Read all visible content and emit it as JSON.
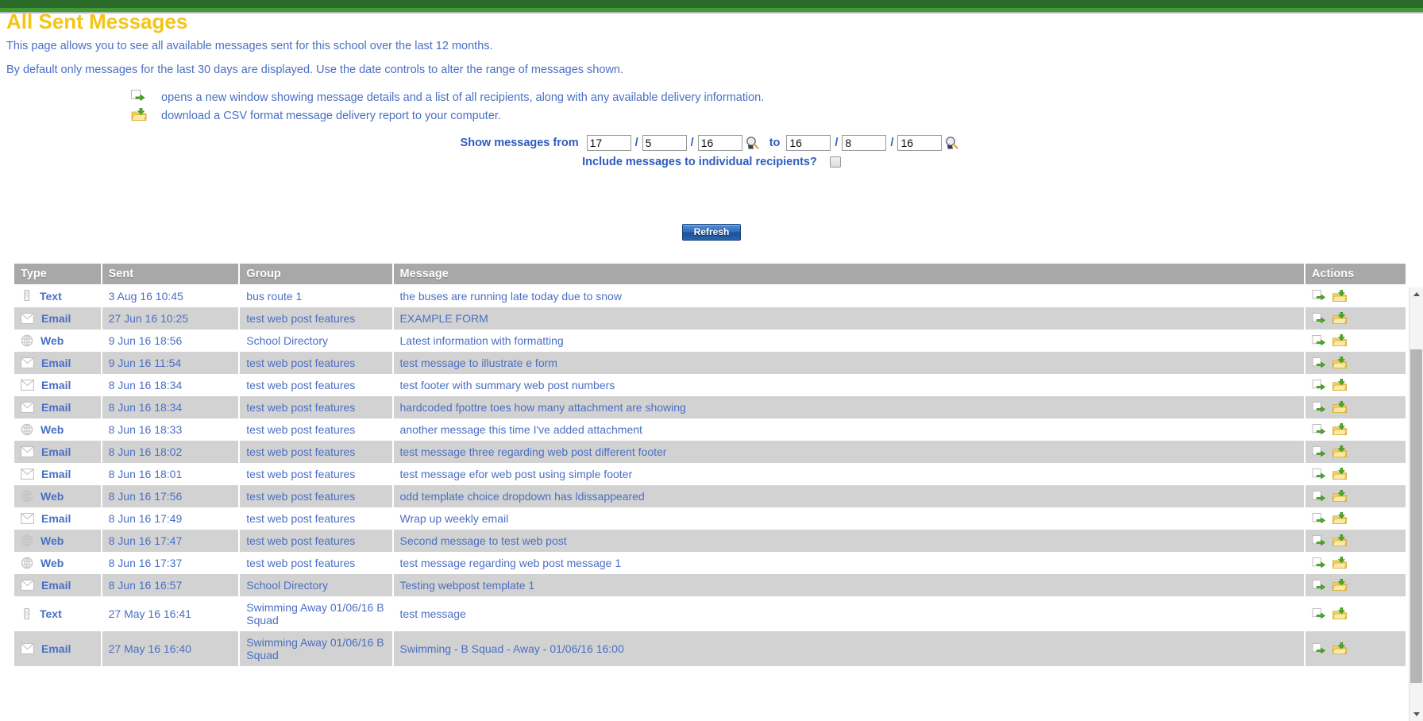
{
  "page": {
    "title": "All Sent Messages",
    "intro_line_1": "This page allows you to see all available messages sent for this school over the last 12 months.",
    "intro_line_2": "By default only messages for the last 30 days are displayed. Use the date controls to alter the range of messages shown.",
    "title_color": "#f2c518",
    "accent_color": "#4a6fc4",
    "bar_color": "#2a6b2a"
  },
  "legend": [
    {
      "icon": "open-window-icon",
      "text": "opens a new window showing message details and a list of all recipients, along with any available delivery information."
    },
    {
      "icon": "download-folder-icon",
      "text": "download a CSV format message delivery report to your computer."
    }
  ],
  "filters": {
    "from_label": "Show messages from",
    "to_label": "to",
    "separator": "/",
    "from_day": "17",
    "from_month": "5",
    "from_year": "16",
    "to_day": "16",
    "to_month": "8",
    "to_year": "16",
    "calendar_icon": "calendar-picker-icon",
    "include_individual_label": "Include messages to individual recipients?",
    "include_individual_checked": false,
    "refresh_label": "Refresh"
  },
  "table": {
    "columns": [
      "Type",
      "Sent",
      "Group",
      "Message",
      "Actions"
    ],
    "rows": [
      {
        "type": "Text",
        "type_icon": "mobile-phone-icon",
        "sent": "3 Aug 16 10:45",
        "group": "bus route 1",
        "message": "the buses are running late today due to snow"
      },
      {
        "type": "Email",
        "type_icon": "envelope-icon",
        "sent": "27 Jun 16 10:25",
        "group": "test web post features",
        "message": "EXAMPLE FORM"
      },
      {
        "type": "Web",
        "type_icon": "globe-icon",
        "sent": "9 Jun 16 18:56",
        "group": "School Directory",
        "message": "Latest information with formatting"
      },
      {
        "type": "Email",
        "type_icon": "envelope-icon",
        "sent": "9 Jun 16 11:54",
        "group": "test web post features",
        "message": "test message to illustrate e form"
      },
      {
        "type": "Email",
        "type_icon": "envelope-icon",
        "sent": "8 Jun 16 18:34",
        "group": "test web post features",
        "message": "test footer with summary web post numbers"
      },
      {
        "type": "Email",
        "type_icon": "envelope-icon",
        "sent": "8 Jun 16 18:34",
        "group": "test web post features",
        "message": "hardcoded fpottre toes how many attachment are showing"
      },
      {
        "type": "Web",
        "type_icon": "globe-icon",
        "sent": "8 Jun 16 18:33",
        "group": "test web post features",
        "message": "another message this time I've added attachment"
      },
      {
        "type": "Email",
        "type_icon": "envelope-icon",
        "sent": "8 Jun 16 18:02",
        "group": "test web post features",
        "message": "test message three regarding web post different footer"
      },
      {
        "type": "Email",
        "type_icon": "envelope-icon",
        "sent": "8 Jun 16 18:01",
        "group": "test web post features",
        "message": "test message efor web post using simple footer"
      },
      {
        "type": "Web",
        "type_icon": "globe-icon",
        "sent": "8 Jun 16 17:56",
        "group": "test web post features",
        "message": "odd template choice dropdown has ldissappeared"
      },
      {
        "type": "Email",
        "type_icon": "envelope-icon",
        "sent": "8 Jun 16 17:49",
        "group": "test web post features",
        "message": "Wrap up weekly email"
      },
      {
        "type": "Web",
        "type_icon": "globe-icon",
        "sent": "8 Jun 16 17:47",
        "group": "test web post features",
        "message": "Second message to test web post"
      },
      {
        "type": "Web",
        "type_icon": "globe-icon",
        "sent": "8 Jun 16 17:37",
        "group": "test web post features",
        "message": "test message regarding web post message 1"
      },
      {
        "type": "Email",
        "type_icon": "envelope-icon",
        "sent": "8 Jun 16 16:57",
        "group": "School Directory",
        "message": "Testing webpost template 1"
      },
      {
        "type": "Text",
        "type_icon": "mobile-phone-icon",
        "sent": "27 May 16 16:41",
        "group": "Swimming Away 01/06/16 B Squad",
        "message": "test message"
      },
      {
        "type": "Email",
        "type_icon": "envelope-icon",
        "sent": "27 May 16 16:40",
        "group": "Swimming Away 01/06/16 B Squad",
        "message": "Swimming - B Squad - Away - 01/06/16 16:00"
      }
    ],
    "row_action_icons": [
      "open-window-icon",
      "download-folder-icon"
    ]
  },
  "scrollbar": {
    "up_icon": "scroll-up-arrow-icon",
    "down_icon": "scroll-down-arrow-icon"
  }
}
